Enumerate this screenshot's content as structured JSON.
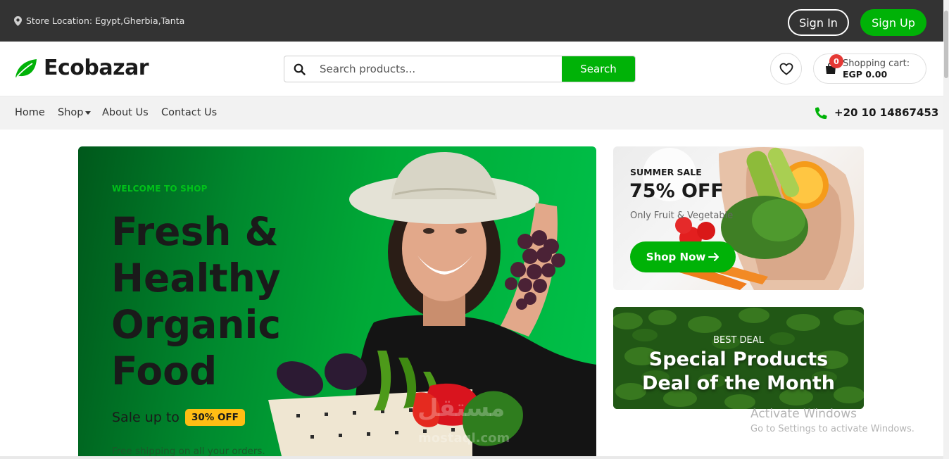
{
  "topbar": {
    "location_icon": "map-pin-icon",
    "location_text": "Store Location: Egypt,Gherbia,Tanta",
    "signin_label": "Sign In",
    "signup_label": "Sign Up"
  },
  "header": {
    "logo_icon": "leaf-icon",
    "logo_text": "Ecobazar",
    "search": {
      "placeholder": "Search products...",
      "value": "",
      "button_label": "Search"
    },
    "wishlist_icon": "heart-icon",
    "cart": {
      "icon": "shopping-bag-icon",
      "count": "0",
      "label": "Shopping cart:",
      "total": "EGP 0.00"
    }
  },
  "nav": {
    "items": [
      {
        "label": "Home"
      },
      {
        "label": "Shop"
      },
      {
        "label": "About Us"
      },
      {
        "label": "Contact Us"
      }
    ],
    "phone_icon": "phone-icon",
    "phone": "+20 10 14867453"
  },
  "hero": {
    "subtitle": "WELCOME TO SHOP",
    "title_lines": [
      "Fresh &",
      "Healthy",
      "Organic",
      "Food"
    ],
    "sale_text": "Sale up to",
    "sale_badge": "30% OFF",
    "shipping_text": "Free shipping on all your orders."
  },
  "banner_summer": {
    "label": "SUMMER SALE",
    "discount": "75% OFF",
    "subtitle": "Only Fruit & Vegetable",
    "button_label": "Shop Now",
    "button_icon": "arrow-right-icon"
  },
  "banner_deal": {
    "label": "BEST DEAL",
    "title_line1": "Special Products",
    "title_line2": "Deal of the Month"
  },
  "os_watermark": {
    "title": "Activate Windows",
    "subtitle": "Go to Settings to activate Windows."
  },
  "image_watermark": {
    "arabic": "مستقل",
    "latin": "mostaql.com"
  },
  "colors": {
    "brand_green": "#00b207",
    "topbar_bg": "#333333",
    "badge_yellow": "#ffbd14",
    "cart_badge_red": "#e53935"
  }
}
